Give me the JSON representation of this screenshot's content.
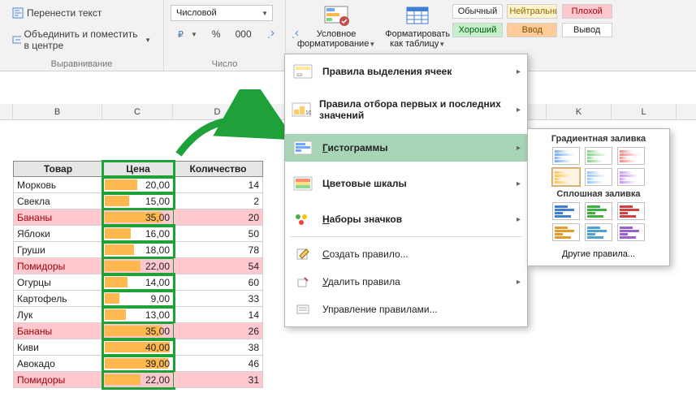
{
  "ribbon": {
    "alignment": {
      "wrap_text": "Перенести текст",
      "merge_center": "Объединить и поместить в центре",
      "group_label": "Выравнивание"
    },
    "number": {
      "format_name": "Числовой",
      "group_label": "Число"
    },
    "cond_fmt": {
      "label_line1": "Условное",
      "label_line2": "форматирование"
    },
    "fmt_table": {
      "label_line1": "Форматировать",
      "label_line2": "как таблицу"
    },
    "styles": {
      "normal": "Обычный",
      "neutral": "Нейтральный",
      "bad": "Плохой",
      "good": "Хороший",
      "input": "Ввод",
      "output": "Вывод"
    }
  },
  "columns": [
    "B",
    "C",
    "D",
    "K",
    "L"
  ],
  "col_widths": {
    "margin": 16,
    "B": 110,
    "C": 87,
    "D": 110
  },
  "table": {
    "headers": {
      "product": "Товар",
      "price": "Цена",
      "qty": "Количество"
    },
    "rows": [
      {
        "product": "Морковь",
        "price": "20,00",
        "bar": 0.5,
        "qty": "14",
        "red": false
      },
      {
        "product": "Свекла",
        "price": "15,00",
        "bar": 0.37,
        "qty": "2",
        "red": false
      },
      {
        "product": "Бананы",
        "price": "35,00",
        "bar": 0.87,
        "qty": "20",
        "red": true
      },
      {
        "product": "Яблоки",
        "price": "16,00",
        "bar": 0.4,
        "qty": "50",
        "red": false
      },
      {
        "product": "Груши",
        "price": "18,00",
        "bar": 0.45,
        "qty": "78",
        "red": false
      },
      {
        "product": "Помидоры",
        "price": "22,00",
        "bar": 0.55,
        "qty": "54",
        "red": true
      },
      {
        "product": "Огурцы",
        "price": "14,00",
        "bar": 0.35,
        "qty": "60",
        "red": false
      },
      {
        "product": "Картофель",
        "price": "9,00",
        "bar": 0.22,
        "qty": "33",
        "red": false
      },
      {
        "product": "Лук",
        "price": "13,00",
        "bar": 0.32,
        "qty": "14",
        "red": false
      },
      {
        "product": "Бананы",
        "price": "35,00",
        "bar": 0.87,
        "qty": "26",
        "red": true
      },
      {
        "product": "Киви",
        "price": "40,00",
        "bar": 1.0,
        "qty": "38",
        "red": false
      },
      {
        "product": "Авокадо",
        "price": "39,00",
        "bar": 0.97,
        "qty": "46",
        "red": false
      },
      {
        "product": "Помидоры",
        "price": "22,00",
        "bar": 0.55,
        "qty": "31",
        "red": true
      }
    ]
  },
  "menu": {
    "highlight_rules": "Правила выделения ячеек",
    "top_bottom": "Правила отбора первых и последних значений",
    "data_bars_u": "Г",
    "data_bars_rest": "истограммы",
    "color_scales": "Цветовые шкалы",
    "icon_sets_u": "Н",
    "icon_sets_rest": "аборы значков",
    "new_rule_u": "С",
    "new_rule_rest": "оздать правило...",
    "clear_u": "У",
    "clear_rest": "далить правила",
    "manage": "Управление правилами..."
  },
  "submenu": {
    "gradient_header": "Градиентная заливка",
    "solid_header": "Сплошная заливка",
    "more_rules": "Другие правила...",
    "gradient_colors": [
      [
        "#6fa8ff",
        "#7fd27f",
        "#ff7f7f"
      ],
      [
        "#ffc04d",
        "#8fc3ff",
        "#c58fff"
      ]
    ],
    "solid_colors": [
      [
        "#3f7fd4",
        "#3fb03f",
        "#d43f3f"
      ],
      [
        "#e69a2b",
        "#4fa0d4",
        "#9a5fd0"
      ]
    ]
  }
}
